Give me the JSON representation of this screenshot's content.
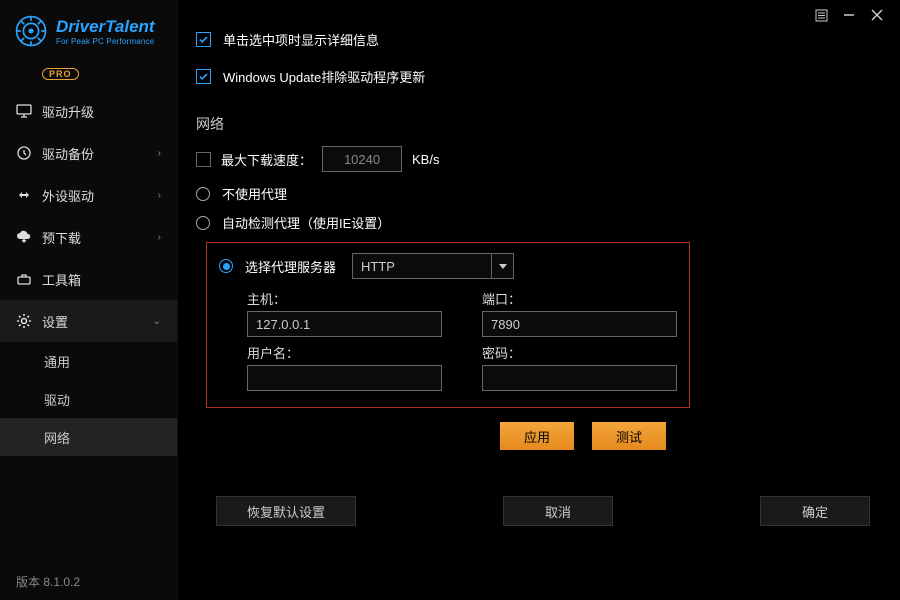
{
  "titlebar": {
    "menu_icon": "menu",
    "min_icon": "minimize",
    "close_icon": "close"
  },
  "brand": {
    "title_first": "Driver",
    "title_second": "Talent",
    "subtitle": "For Peak PC Performance",
    "badge": "PRO"
  },
  "sidebar": {
    "items": [
      {
        "label": "驱动升级"
      },
      {
        "label": "驱动备份"
      },
      {
        "label": "外设驱动"
      },
      {
        "label": "预下载"
      },
      {
        "label": "工具箱"
      },
      {
        "label": "设置"
      }
    ],
    "subitems": [
      {
        "label": "通用"
      },
      {
        "label": "驱动"
      },
      {
        "label": "网络"
      }
    ]
  },
  "version": "版本 8.1.0.2",
  "checks": {
    "detail_label": "单击选中项时显示详细信息",
    "wu_label": "Windows Update排除驱动程序更新"
  },
  "network": {
    "section_title": "网络",
    "max_speed_label": "最大下载速度：",
    "max_speed_value": "10240",
    "max_speed_unit": "KB/s",
    "no_proxy_label": "不使用代理",
    "auto_proxy_label": "自动检测代理（使用IE设置）",
    "select_proxy_label": "选择代理服务器",
    "proxy_type": "HTTP",
    "host_label": "主机：",
    "host_value": "127.0.0.1",
    "port_label": "端口：",
    "port_value": "7890",
    "user_label": "用户名：",
    "user_value": "",
    "pass_label": "密码：",
    "pass_value": ""
  },
  "actions": {
    "apply": "应用",
    "test": "测试",
    "restore": "恢复默认设置",
    "cancel": "取消",
    "ok": "确定"
  }
}
